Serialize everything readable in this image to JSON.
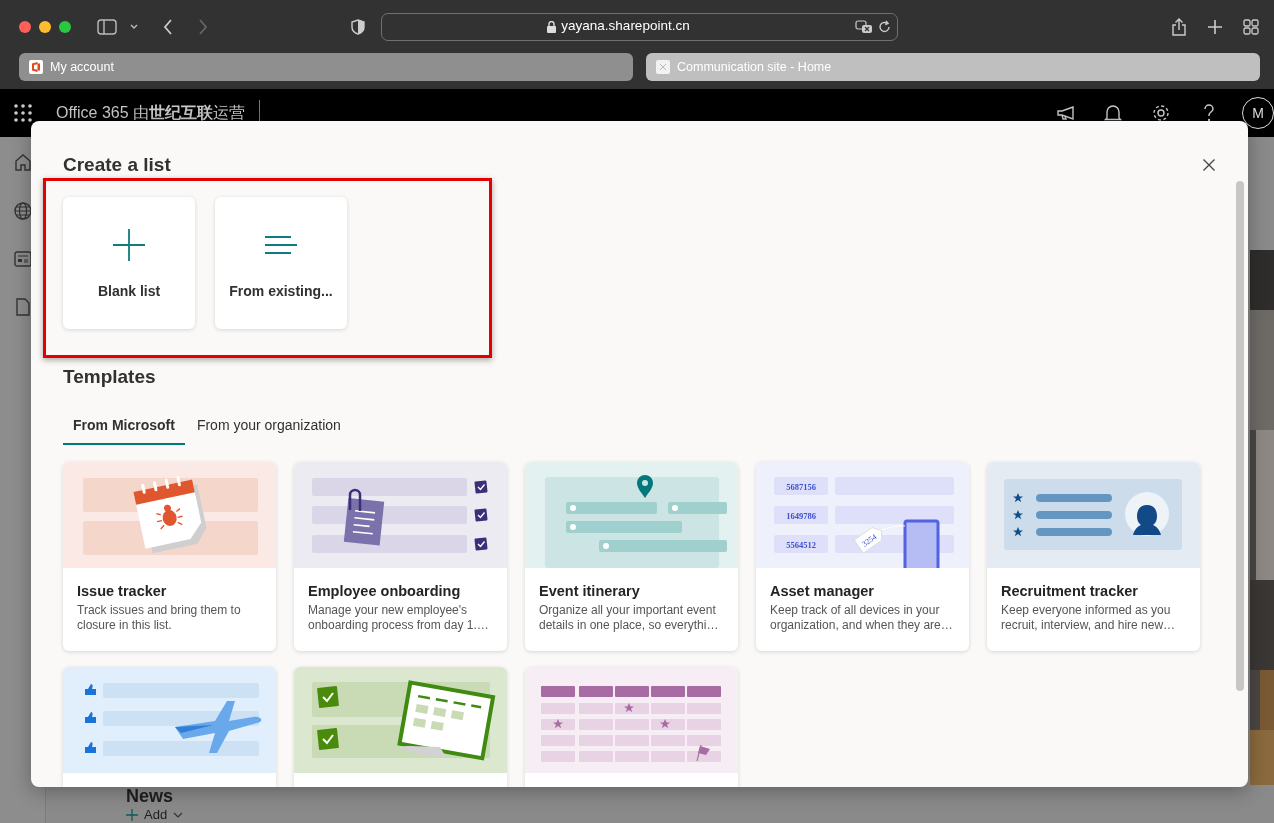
{
  "browser": {
    "address": "yayana.sharepoint.cn",
    "can_go_forward": false,
    "tabs": [
      {
        "title": "My account",
        "selected": false
      },
      {
        "title": "Communication site - Home",
        "selected": true
      }
    ]
  },
  "suite_bar": {
    "brand": "Office 365 由**世纪互联**运营",
    "avatar": "M"
  },
  "page_behind": {
    "heading": "News",
    "add_label": "Add"
  },
  "dialog": {
    "title": "Create a list",
    "create_highlighted": true,
    "create_options": [
      {
        "kind": "blank",
        "label": "Blank list"
      },
      {
        "kind": "existing",
        "label": "From existing..."
      }
    ],
    "templates_heading": "Templates",
    "tabs": [
      {
        "label": "From Microsoft",
        "selected": true
      },
      {
        "label": "From your organization",
        "selected": false
      }
    ],
    "templates": [
      {
        "kind": "issue",
        "title": "Issue tracker",
        "description": "Track issues and bring them to closure in this list."
      },
      {
        "kind": "onboarding",
        "title": "Employee onboarding",
        "description": "Manage your new employee's onboarding process from day 1.…"
      },
      {
        "kind": "event",
        "title": "Event itinerary",
        "description": "Organize all your important event details in one place, so everythi…"
      },
      {
        "kind": "asset",
        "title": "Asset manager",
        "description": "Keep track of all devices in your organization, and when they are…",
        "numbers": [
          "5687156",
          "1649786",
          "5564512"
        ],
        "tag": "3254"
      },
      {
        "kind": "recruit",
        "title": "Recruitment tracker",
        "description": "Keep everyone informed as you recruit, interview, and hire new…"
      },
      {
        "kind": "travel"
      },
      {
        "kind": "approvals"
      },
      {
        "kind": "schedule"
      }
    ]
  }
}
